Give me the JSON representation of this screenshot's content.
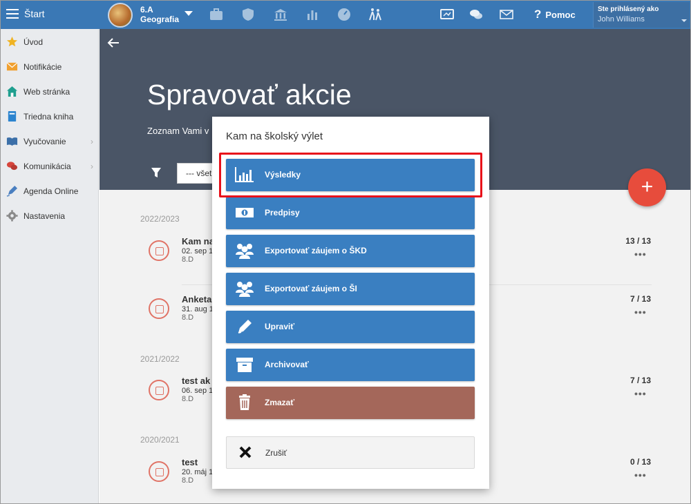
{
  "topbar": {
    "start_label": "Štart",
    "class_name": "6.A",
    "subject": "Geografia",
    "help_label": "Pomoc",
    "user_caption": "Ste prihlásený ako",
    "user_name": "John Williams"
  },
  "sidebar": {
    "items": [
      {
        "label": "Úvod",
        "icon": "star-icon",
        "has_arrow": false
      },
      {
        "label": "Notifikácie",
        "icon": "envelope-icon",
        "has_arrow": false
      },
      {
        "label": "Web stránka",
        "icon": "home-icon",
        "has_arrow": false
      },
      {
        "label": "Triedna kniha",
        "icon": "book-icon",
        "has_arrow": false
      },
      {
        "label": "Vyučovanie",
        "icon": "open-book-icon",
        "has_arrow": true
      },
      {
        "label": "Komunikácia",
        "icon": "chat-icon",
        "has_arrow": true
      },
      {
        "label": "Agenda Online",
        "icon": "pen-icon",
        "has_arrow": false
      },
      {
        "label": "Nastavenia",
        "icon": "gear-icon",
        "has_arrow": false
      }
    ]
  },
  "hero": {
    "title": "Spravovať akcie",
    "subtitle": "Zoznam Vami v",
    "filter_value": "--- všet"
  },
  "list": {
    "years": [
      "2022/2023",
      "2021/2022",
      "2020/2021"
    ],
    "rows": [
      {
        "title": "Kam na",
        "date": "02. sep 1",
        "class": "8.D",
        "count": "13 / 13"
      },
      {
        "title": "Anketa",
        "date": "31. aug 1",
        "class": "8.D",
        "count": "7 / 13"
      },
      {
        "title": "test ak",
        "date": "06. sep 1",
        "class": "8.D",
        "count": "7 / 13"
      },
      {
        "title": "test",
        "date": "20. máj 1",
        "class": "8.D",
        "count": "0 / 13"
      }
    ],
    "more_label": "•••"
  },
  "modal": {
    "title": "Kam na školský výlet",
    "buttons": {
      "results": "Výsledky",
      "fees": "Predpisy",
      "export_skd": "Exportovať záujem o ŠKD",
      "export_si": "Exportovať záujem o ŠI",
      "edit": "Upraviť",
      "archive": "Archivovať",
      "delete": "Zmazať",
      "cancel": "Zrušiť"
    }
  },
  "colors": {
    "topbar": "#3a78b5",
    "primary_button": "#3a7fc1",
    "delete_button": "#a4675a",
    "fab": "#e74c3c",
    "highlight": "#e8101a"
  }
}
